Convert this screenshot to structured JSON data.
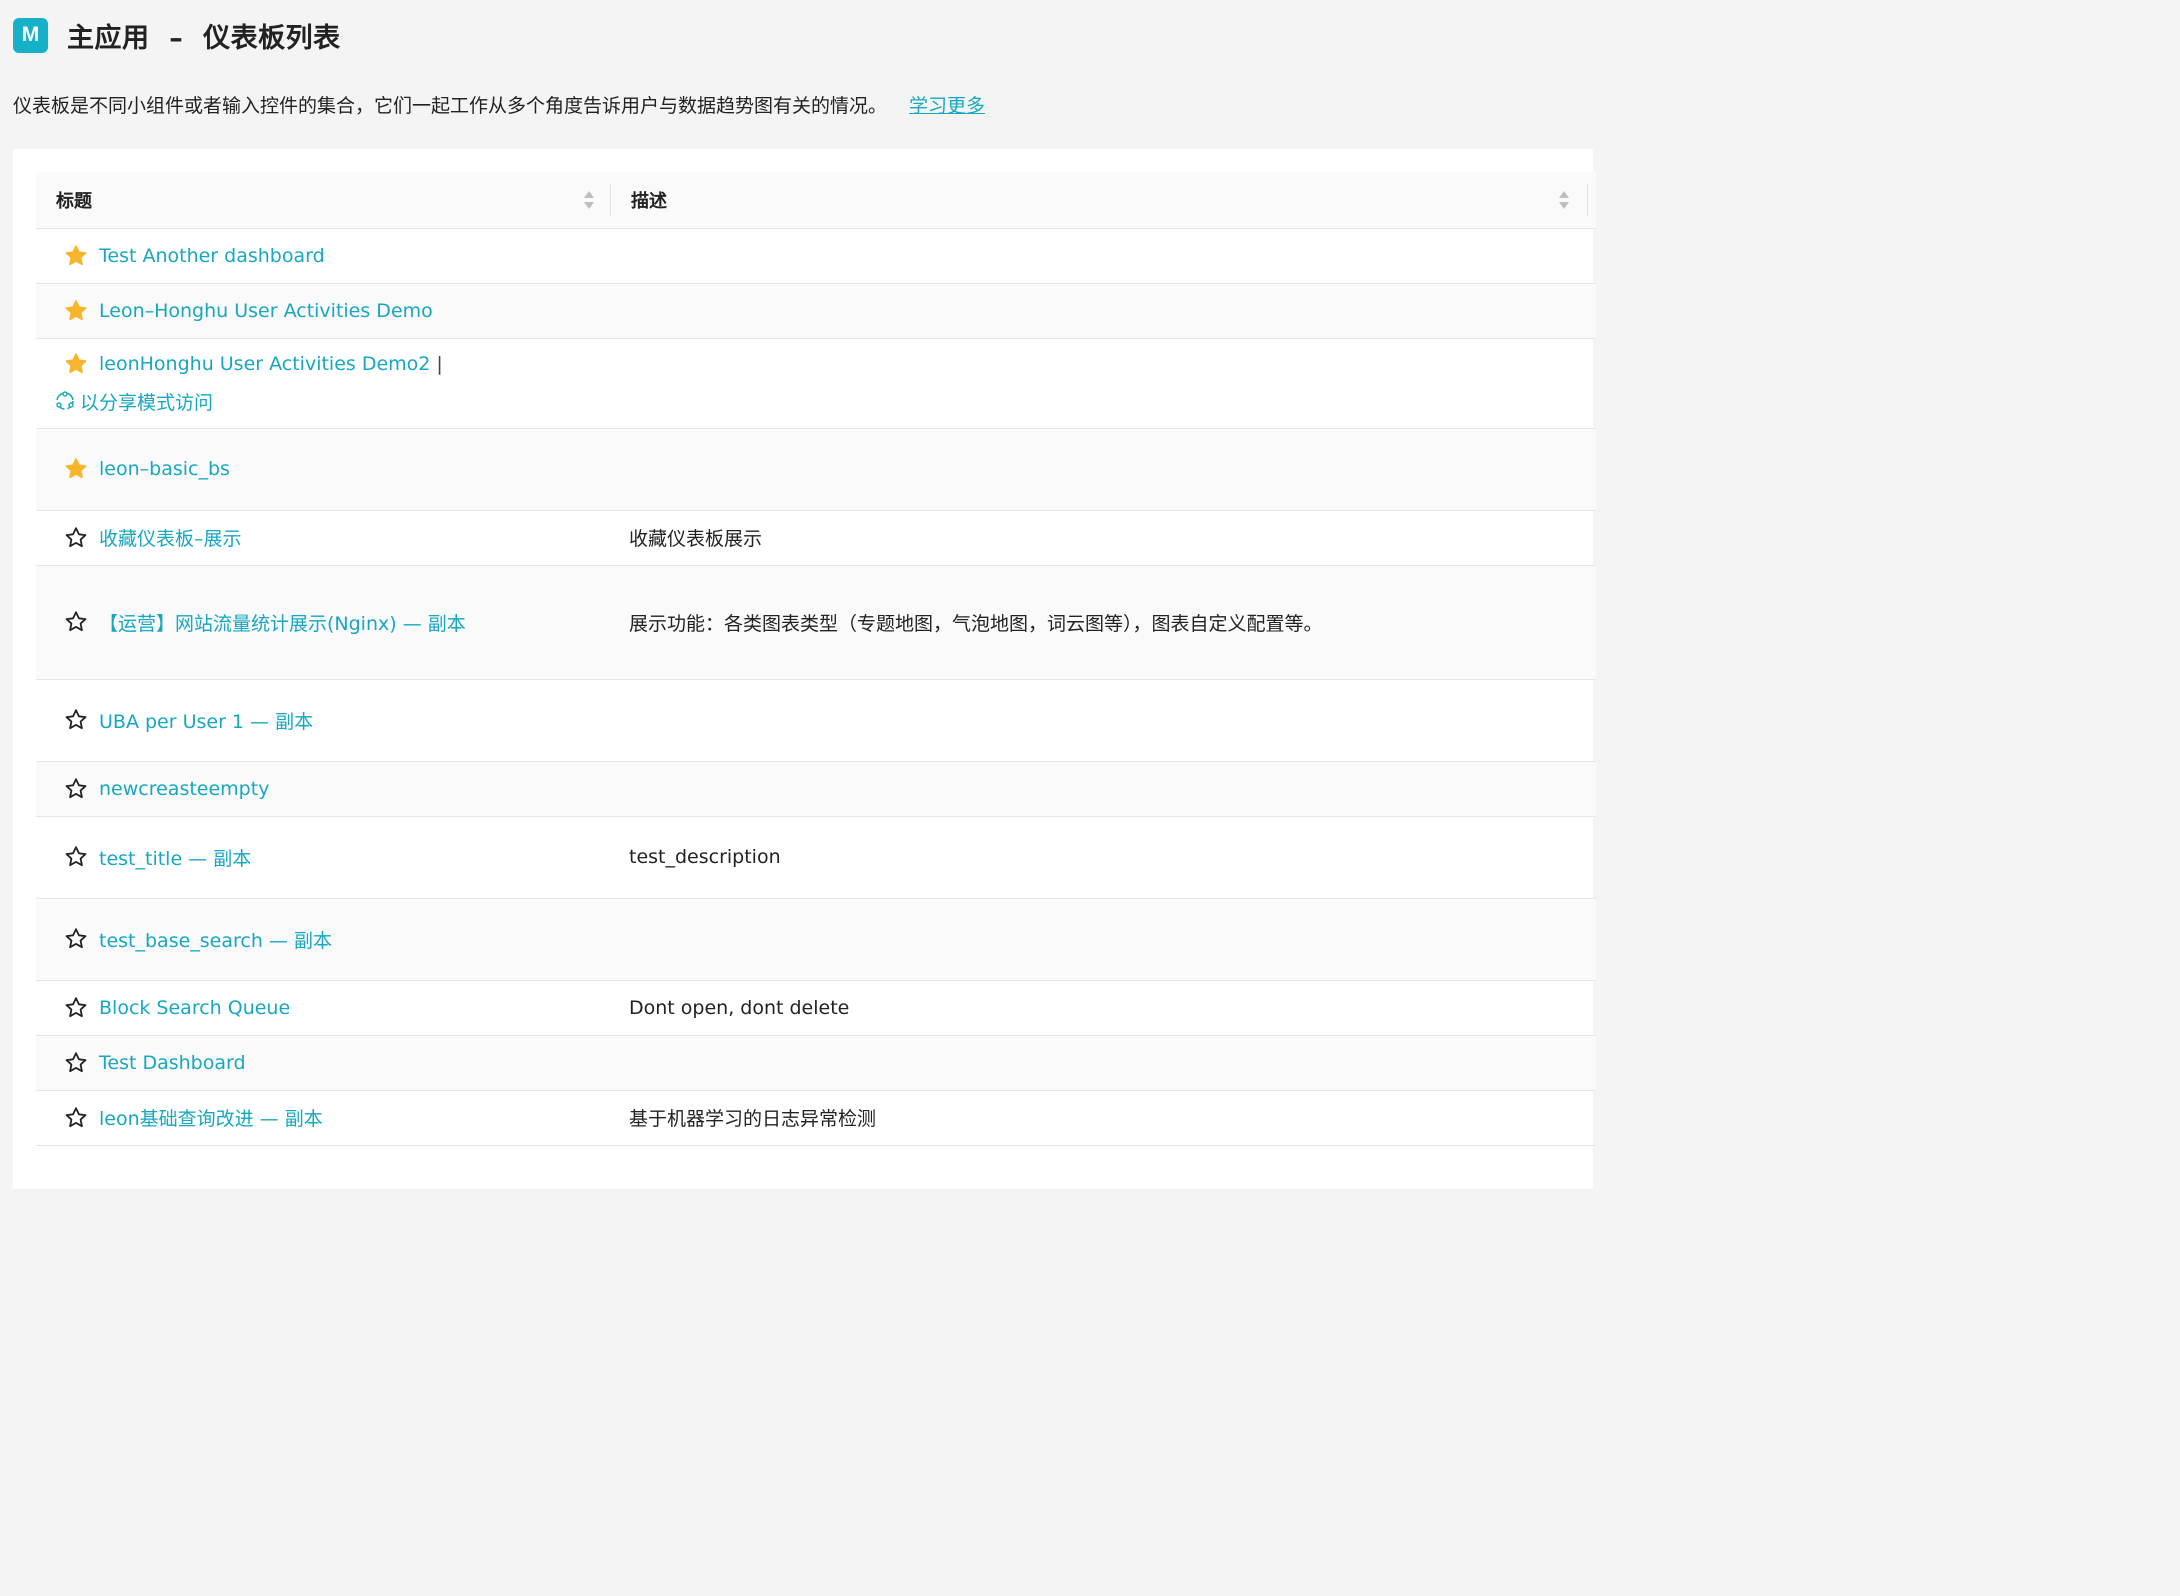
{
  "header": {
    "badge": "M",
    "title": "主应用  –  仪表板列表"
  },
  "intro": {
    "text": "仪表板是不同小组件或者输入控件的集合，它们一起工作从多个角度告诉用户与数据趋势图有关的情况。",
    "learn_more": "学习更多"
  },
  "table": {
    "columns": [
      "标题",
      "描述"
    ],
    "rows": [
      {
        "title": "Test Another dashboard",
        "description": "",
        "starred": true,
        "height": 55
      },
      {
        "title": "Leon–Honghu User Activities Demo",
        "description": "",
        "starred": true,
        "height": 55
      },
      {
        "title": "leonHonghu User Activities Demo2",
        "description": "",
        "starred": true,
        "pipe": "|",
        "share": "以分享模式访问",
        "height": 90
      },
      {
        "title": "leon–basic_bs",
        "description": "",
        "starred": true,
        "height": 82
      },
      {
        "title": "收藏仪表板–展示",
        "description": "收藏仪表板展示",
        "starred": false,
        "height": 55
      },
      {
        "title": "【运营】网站流量统计展示(Nginx) — 副本",
        "description": "展示功能：各类图表类型（专题地图，气泡地图，词云图等），图表自定义配置等。",
        "starred": false,
        "height": 114
      },
      {
        "title": "UBA per User 1 — 副本",
        "description": "",
        "starred": false,
        "height": 82
      },
      {
        "title": "newcreasteempty",
        "description": "",
        "starred": false,
        "height": 55
      },
      {
        "title": "test_title — 副本",
        "description": "test_description",
        "starred": false,
        "height": 82
      },
      {
        "title": "test_base_search — 副本",
        "description": "",
        "starred": false,
        "height": 82
      },
      {
        "title": "Block Search Queue",
        "description": "Dont open, dont delete",
        "starred": false,
        "height": 55
      },
      {
        "title": "Test Dashboard",
        "description": "",
        "starred": false,
        "height": 55
      },
      {
        "title": "leon基础查询改进 — 副本",
        "description": "基于机器学习的日志异常检测",
        "starred": false,
        "height": 55
      }
    ]
  },
  "colors": {
    "accent": "#17a7c0",
    "star_filled": "#f7b52c",
    "star_outline": "#222222",
    "badge": "#17b0c9"
  }
}
